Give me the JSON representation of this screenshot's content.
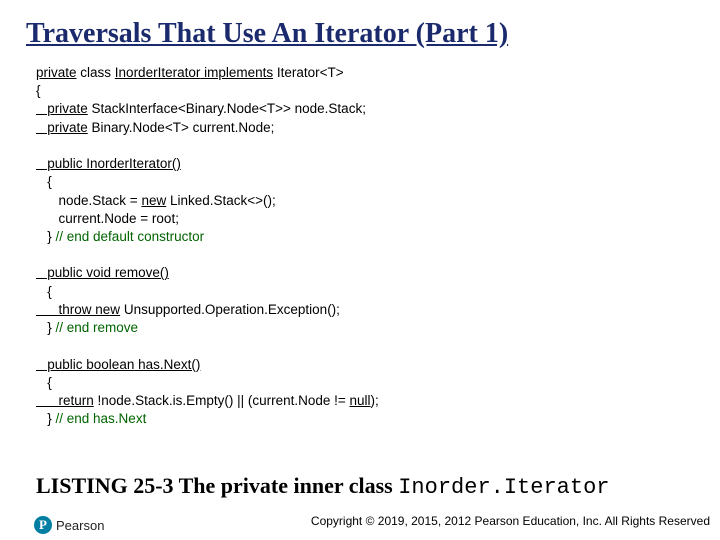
{
  "title": "Traversals That Use An Iterator (Part 1)",
  "code": {
    "l1a": "private",
    "l1b": " class ",
    "l1c": "InorderIterator",
    "l1d": " implements",
    "l1e": " Iterator<T>",
    "l2": "{",
    "l3a": "   private",
    "l3b": " StackInterface<Binary.Node<T>> node.Stack;",
    "l4a": "   private",
    "l4b": " Binary.Node<T> current.Node;",
    "sp1": " ",
    "l5a": "   public",
    "l5b": " InorderIterator()",
    "l6": "   {",
    "l7a": "      node.Stack = ",
    "l7b": "new",
    "l7c": " Linked.Stack<>();",
    "l8": "      current.Node = root;",
    "l9a": "   } ",
    "l9b": "// end default constructor",
    "sp2": " ",
    "l10a": "   public",
    "l10b": " void",
    "l10c": " remove()",
    "l11": "   {",
    "l12a": "      throw",
    "l12b": " new",
    "l12c": " Unsupported.Operation.Exception();",
    "l13a": "   } ",
    "l13b": "// end remove",
    "sp3": " ",
    "l14a": "   public",
    "l14b": " boolean",
    "l14c": " has.Next()",
    "l15": "   {",
    "l16a": "      return",
    "l16b": " !node.Stack.is.Empty() || (current.Node != ",
    "l16c": "null",
    "l16d": ");",
    "l17a": "   } ",
    "l17b": "// end has.Next"
  },
  "caption_prefix": "LISTING 25-3 The private inner class ",
  "caption_mono": "Inorder.Iterator",
  "copyright": "Copyright © 2019, 2015, 2012 Pearson Education, Inc. All Rights Reserved",
  "logo_letter": "P",
  "logo_word": "Pearson"
}
